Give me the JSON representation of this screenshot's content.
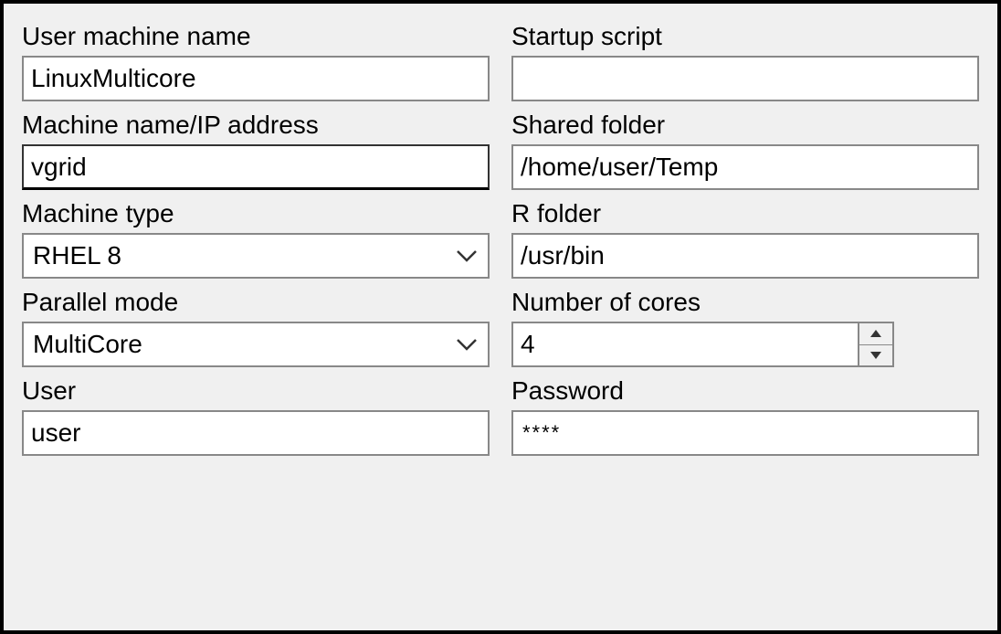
{
  "labels": {
    "user_machine_name": "User machine name",
    "startup_script": "Startup script",
    "machine_name_ip": "Machine name/IP address",
    "shared_folder": "Shared folder",
    "machine_type": "Machine type",
    "r_folder": "R folder",
    "parallel_mode": "Parallel mode",
    "number_of_cores": "Number of cores",
    "user": "User",
    "password": "Password"
  },
  "values": {
    "user_machine_name": "LinuxMulticore",
    "startup_script": "",
    "machine_name_ip": "vgrid",
    "shared_folder": "/home/user/Temp",
    "machine_type": "RHEL 8",
    "r_folder": "/usr/bin",
    "parallel_mode": "MultiCore",
    "number_of_cores": "4",
    "user": "user",
    "password_mask": "****"
  }
}
